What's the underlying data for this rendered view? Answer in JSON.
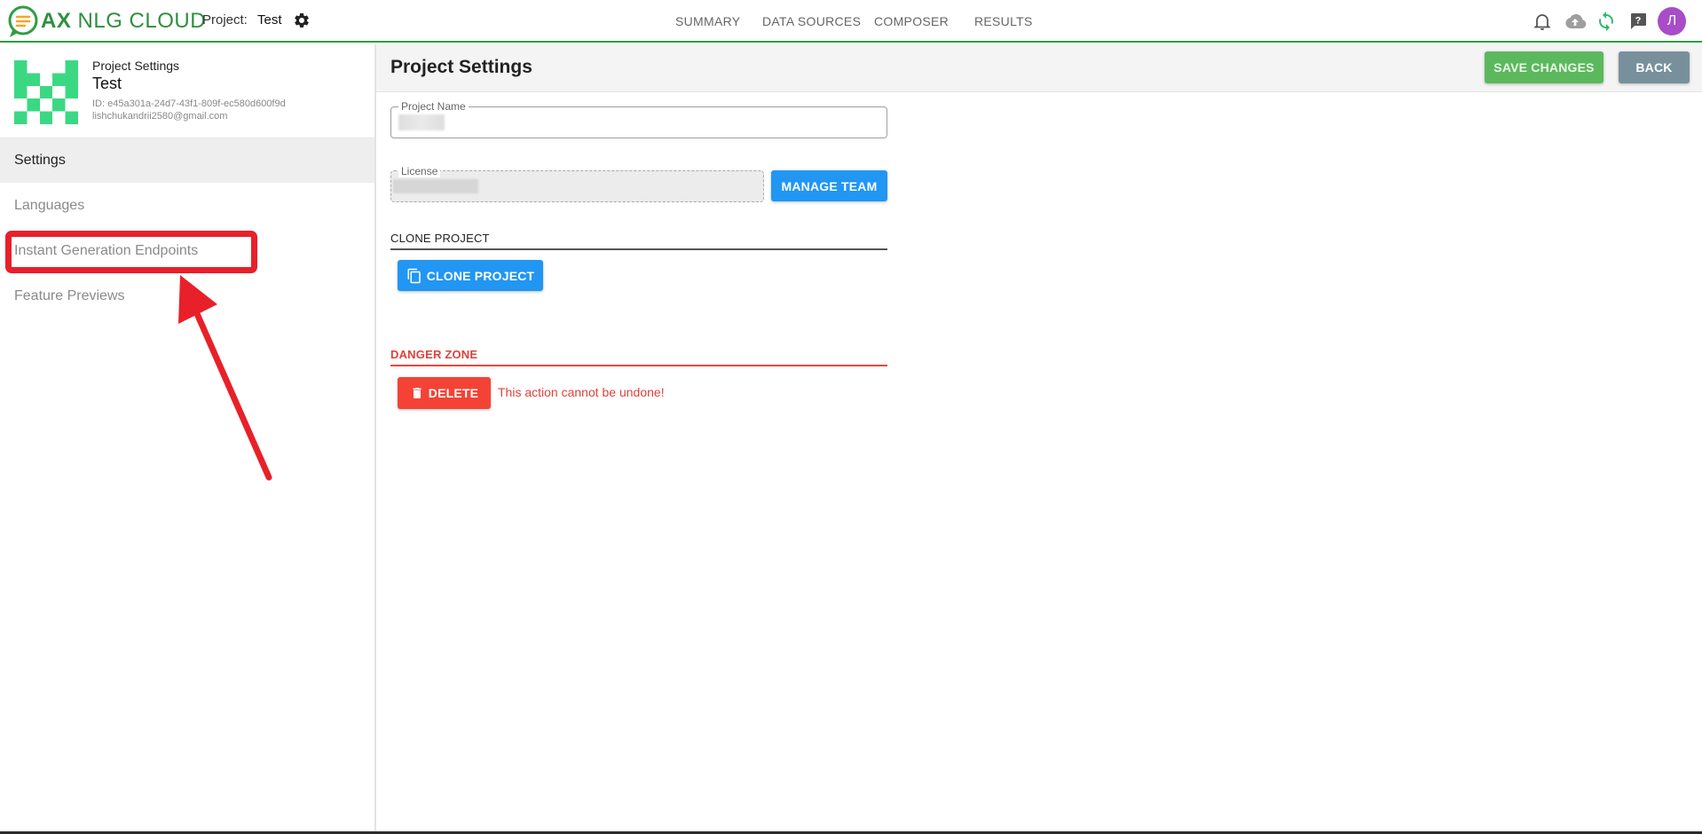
{
  "app": {
    "logo_bold": "AX",
    "logo_rest": " NLG CLOUD",
    "project_label": "Project:",
    "project_name": "Test"
  },
  "nav": {
    "items": [
      "SUMMARY",
      "DATA SOURCES",
      "COMPOSER",
      "RESULTS"
    ]
  },
  "top_icons": [
    "bell-icon",
    "cloud-upload-icon",
    "sync-icon",
    "feedback-icon"
  ],
  "user": {
    "avatar_initial": "Л"
  },
  "sidebar": {
    "title": "Project Settings",
    "project_name": "Test",
    "project_id": "ID: e45a301a-24d7-43f1-809f-ec580d600f9d",
    "email": "lishchukandrii2580@gmail.com",
    "items": [
      {
        "label": "Settings",
        "active": true
      },
      {
        "label": "Languages",
        "active": false
      },
      {
        "label": "Instant Generation Endpoints",
        "active": false
      },
      {
        "label": "Feature Previews",
        "active": false
      }
    ]
  },
  "main": {
    "title": "Project Settings",
    "save_label": "SAVE CHANGES",
    "back_label": "BACK",
    "project_name_legend": "Project Name",
    "license_legend": "License",
    "manage_team_label": "MANAGE TEAM",
    "clone_section": "CLONE PROJECT",
    "clone_button": "CLONE PROJECT",
    "danger_section": "DANGER ZONE",
    "delete_button": "DELETE",
    "delete_warning": "This action cannot be undone!"
  },
  "colors": {
    "brand_green": "#2e9e44",
    "primary_blue": "#2196f3",
    "danger_red": "#f44336",
    "save_green": "#5cb85c",
    "back_grey": "#78909c",
    "annotation_red": "#e8202a",
    "avatar_purple": "#a84cc8"
  }
}
